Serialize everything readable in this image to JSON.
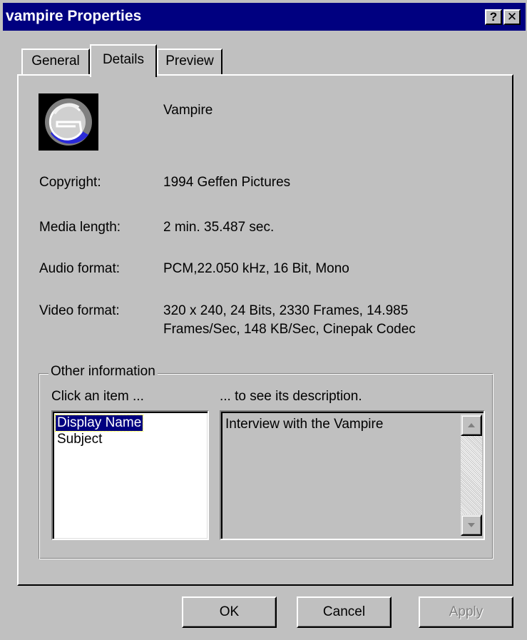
{
  "window": {
    "title": "vampire Properties",
    "help_label": "?",
    "close_label": "✕"
  },
  "tabs": [
    {
      "label": "General"
    },
    {
      "label": "Details",
      "selected": true
    },
    {
      "label": "Preview"
    }
  ],
  "details": {
    "file_icon": "media-clip-icon",
    "name": "Vampire",
    "properties": [
      {
        "label": "Copyright:",
        "value": "1994 Geffen Pictures"
      },
      {
        "label": "Media length:",
        "value": "2 min. 35.487 sec."
      },
      {
        "label": "Audio format:",
        "value": "PCM,22.050 kHz, 16 Bit, Mono"
      },
      {
        "label": "Video format:",
        "value": "320 x 240, 24 Bits, 2330 Frames, 14.985 Frames/Sec, 148 KB/Sec, Cinepak Codec"
      }
    ]
  },
  "other_info": {
    "legend": "Other information",
    "click_hint": "Click an item ...",
    "desc_hint": "... to see its description.",
    "items": [
      "Display Name",
      "Subject"
    ],
    "selected_item": "Display Name",
    "description": "Interview with the Vampire"
  },
  "buttons": {
    "ok": "OK",
    "cancel": "Cancel",
    "apply": "Apply"
  },
  "colors": {
    "titlebar": "#000080",
    "face": "#c0c0c0",
    "selection": "#000080"
  }
}
